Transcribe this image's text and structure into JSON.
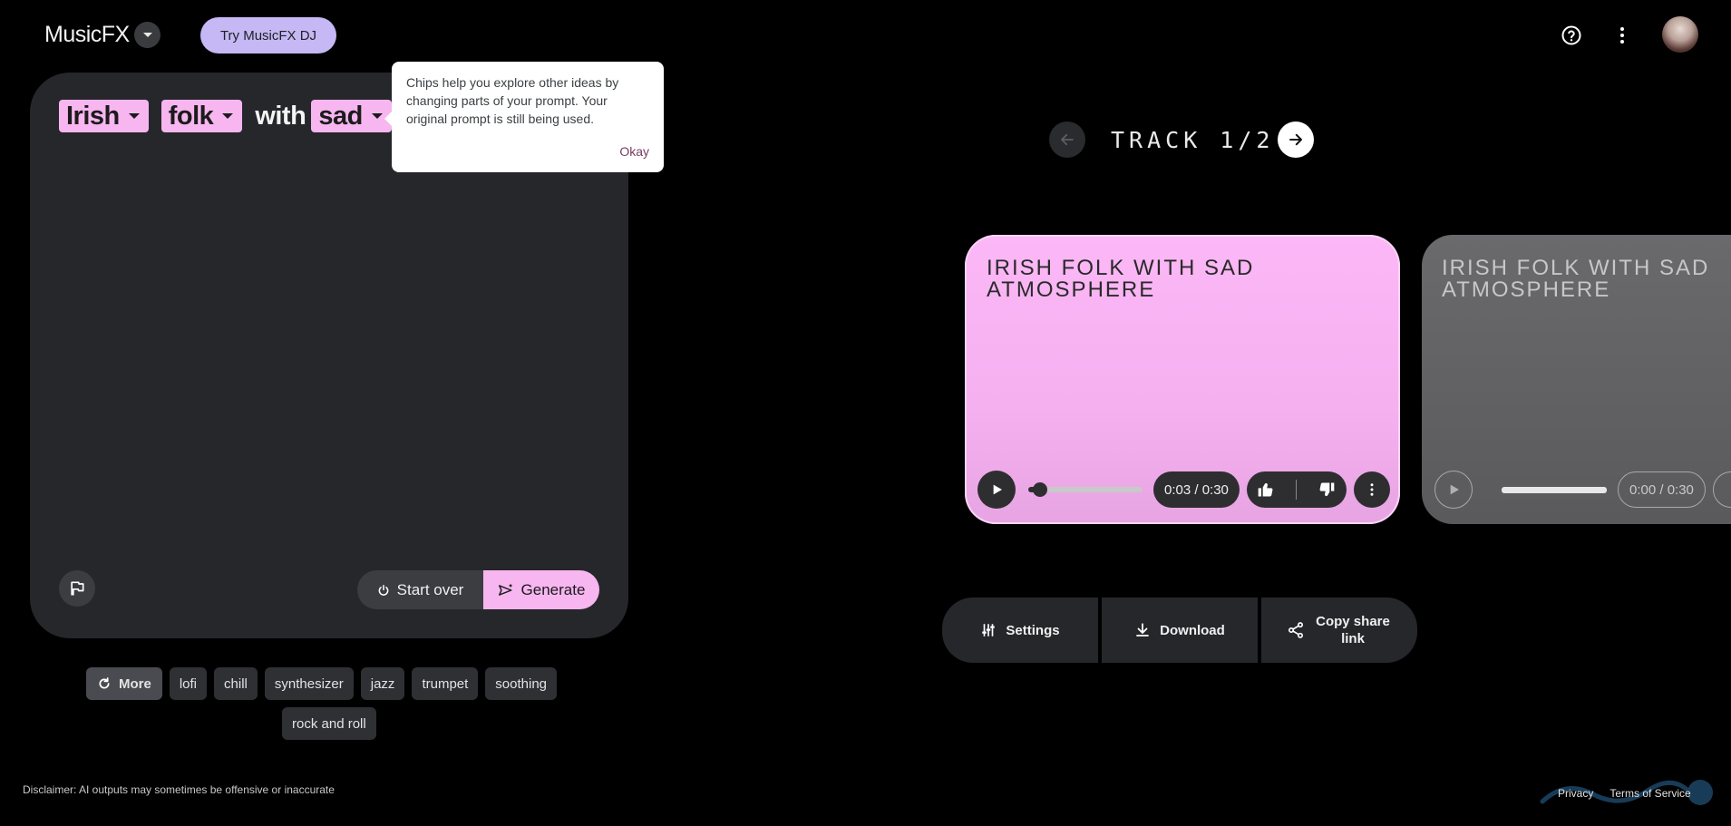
{
  "header": {
    "brand": "MusicFX",
    "dj_button": "Try MusicFX DJ"
  },
  "prompt": {
    "chip1": "Irish",
    "chip2": "folk",
    "word": "with",
    "chip3": "sad"
  },
  "tooltip": {
    "message": "Chips help you explore other ideas by changing parts of your prompt. Your original prompt is still being used.",
    "okay": "Okay"
  },
  "panel": {
    "start_over": "Start over",
    "generate": "Generate"
  },
  "suggestions": {
    "more": "More",
    "items": [
      "lofi",
      "chill",
      "synthesizer",
      "jazz",
      "trumpet",
      "soothing"
    ],
    "row2": "rock and roll"
  },
  "disclaimer": "Disclaimer: AI outputs may sometimes be offensive or inaccurate",
  "track_nav": {
    "label": "TRACK 1/2"
  },
  "tracks": [
    {
      "title": "IRISH FOLK WITH SAD ATMOSPHERE",
      "time": "0:03 / 0:30",
      "progress": 0.1
    },
    {
      "title": "IRISH FOLK WITH SAD ATMOSPHERE",
      "time": "0:00 / 0:30",
      "progress": 0
    }
  ],
  "actions": {
    "settings": "Settings",
    "download": "Download",
    "share": "Copy share link"
  },
  "footer": {
    "privacy": "Privacy",
    "terms": "Terms of Service"
  },
  "colors": {
    "accent_pink": "#f7b6f0",
    "dj_purple": "#c5b8f4",
    "panel": "#26272b"
  }
}
